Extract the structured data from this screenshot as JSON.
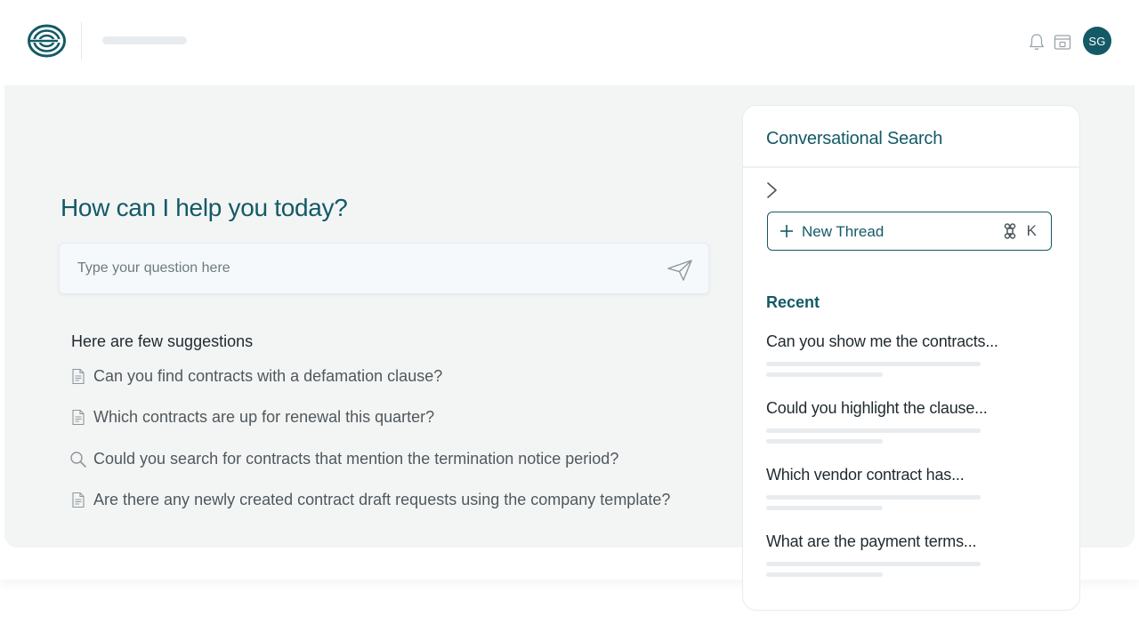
{
  "header": {
    "logo_icon": "concentric-rings-logo",
    "avatar_initials": "SG",
    "icons": [
      "bell-icon",
      "window-icon"
    ],
    "accent_color": "#135a66"
  },
  "main": {
    "greeting": "How can I help you today?",
    "ask": {
      "placeholder": "Type your question here",
      "value": "",
      "send_icon": "send-icon"
    },
    "suggestions": {
      "title": "Here are few suggestions",
      "items": [
        {
          "label": "Can you find contracts with a defamation clause?",
          "icon": "document-icon"
        },
        {
          "label": "Which contracts are up for renewal this quarter?",
          "icon": "document-icon"
        },
        {
          "label": "Could you search for contracts that mention the termination notice period?",
          "icon": "search-icon"
        },
        {
          "label": "Are there any newly created contract draft requests using the company template?",
          "icon": "document-icon"
        }
      ]
    }
  },
  "side": {
    "title": "Conversational Search",
    "new_thread": {
      "label": "New Thread",
      "shortcut_key": "K",
      "shortcut_icon": "command-icon"
    },
    "recent_title": "Recent",
    "recent": [
      {
        "label": "Can you show me the contracts..."
      },
      {
        "label": "Could you highlight the clause..."
      },
      {
        "label": "Which vendor contract has..."
      },
      {
        "label": "What are the payment terms..."
      }
    ]
  }
}
